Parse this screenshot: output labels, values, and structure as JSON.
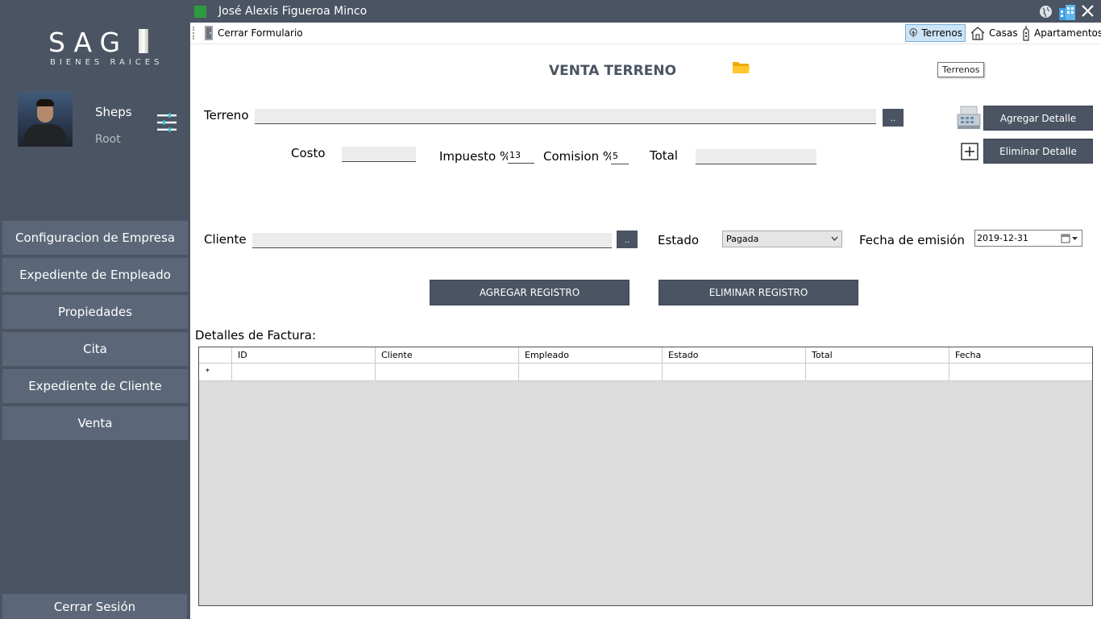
{
  "window": {
    "title": "José Alexis Figueroa Minco"
  },
  "sidebar": {
    "logo_text": "SAG",
    "logo_sub": "BIENES RAICES",
    "user": {
      "name": "Sheps",
      "role": "Root"
    },
    "items": [
      {
        "label": "Configuracion de Empresa"
      },
      {
        "label": "Expediente de Empleado"
      },
      {
        "label": "Propiedades"
      },
      {
        "label": "Cita"
      },
      {
        "label": "Expediente de Cliente"
      },
      {
        "label": "Venta"
      }
    ],
    "logout_label": "Cerrar Sesión"
  },
  "toolbar": {
    "close_form": "Cerrar Formulario",
    "terrenos": "Terrenos",
    "casas": "Casas",
    "apartamentos": "Apartamentos",
    "tooltip": "Terrenos"
  },
  "form": {
    "title": "VENTA TERRENO",
    "terreno_label": "Terreno",
    "terreno_value": "",
    "browse_label": "..",
    "costo_label": "Costo",
    "costo_value": "",
    "impuesto_label": "Impuesto %",
    "impuesto_value": "13",
    "comision_label": "Comision %",
    "comision_value": "5",
    "total_label": "Total",
    "total_value": "",
    "add_detail": "Agregar Detalle",
    "remove_detail": "Eliminar Detalle",
    "cliente_label": "Cliente",
    "cliente_value": "",
    "estado_label": "Estado",
    "estado_value": "Pagada",
    "fecha_label": "Fecha de emisión",
    "fecha_value": "2019-12-31",
    "add_record": "AGREGAR REGISTRO",
    "remove_record": "ELIMINAR REGISTRO",
    "details_label": "Detalles de Factura:"
  },
  "grid": {
    "columns": [
      "ID",
      "Cliente",
      "Empleado",
      "Estado",
      "Total",
      "Fecha"
    ],
    "new_row_marker": "*"
  },
  "colors": {
    "sidebar": "#4b5463",
    "button": "#5b6778",
    "accent": "#2e9a3e"
  }
}
